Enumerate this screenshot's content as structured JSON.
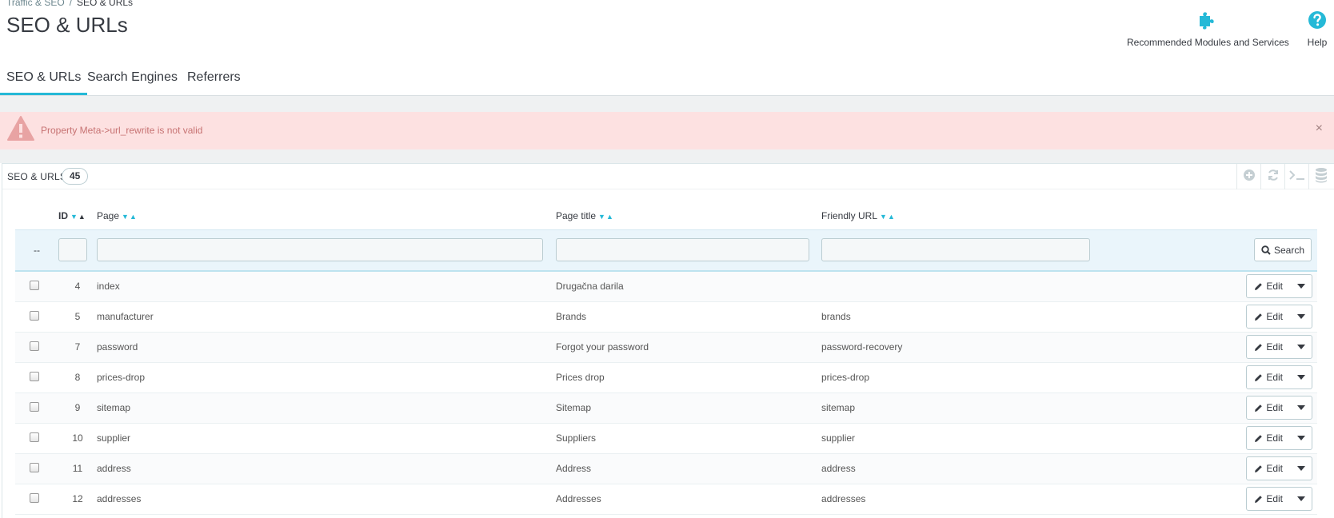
{
  "breadcrumb": {
    "parent": "Traffic & SEO",
    "separator": "/",
    "current": "SEO & URLs"
  },
  "page": {
    "title": "SEO & URLs"
  },
  "toolbar": {
    "modules_label": "Recommended Modules and Services",
    "help_label": "Help",
    "modules_icon": "puzzle-icon",
    "help_icon": "question-circle-icon"
  },
  "tabs": [
    {
      "label": "SEO & URLs",
      "active": true
    },
    {
      "label": "Search Engines",
      "active": false
    },
    {
      "label": "Referrers",
      "active": false
    }
  ],
  "alert": {
    "message": "Property Meta->url_rewrite is not valid",
    "close": "×"
  },
  "panel": {
    "title": "SEO & URLS",
    "count": "45"
  },
  "table": {
    "columns": {
      "id": "ID",
      "page": "Page",
      "page_title": "Page title",
      "friendly_url": "Friendly URL"
    },
    "filter": {
      "dash": "--",
      "search_label": "Search"
    },
    "edit_label": "Edit",
    "rows": [
      {
        "id": "4",
        "page": "index",
        "title": "Drugačna darila",
        "url": ""
      },
      {
        "id": "5",
        "page": "manufacturer",
        "title": "Brands",
        "url": "brands"
      },
      {
        "id": "7",
        "page": "password",
        "title": "Forgot your password",
        "url": "password-recovery"
      },
      {
        "id": "8",
        "page": "prices-drop",
        "title": "Prices drop",
        "url": "prices-drop"
      },
      {
        "id": "9",
        "page": "sitemap",
        "title": "Sitemap",
        "url": "sitemap"
      },
      {
        "id": "10",
        "page": "supplier",
        "title": "Suppliers",
        "url": "supplier"
      },
      {
        "id": "11",
        "page": "address",
        "title": "Address",
        "url": "address"
      },
      {
        "id": "12",
        "page": "addresses",
        "title": "Addresses",
        "url": "addresses"
      }
    ]
  },
  "colors": {
    "accent": "#25b9d7",
    "alert_bg": "#fde1e1",
    "alert_text": "#c77373"
  }
}
